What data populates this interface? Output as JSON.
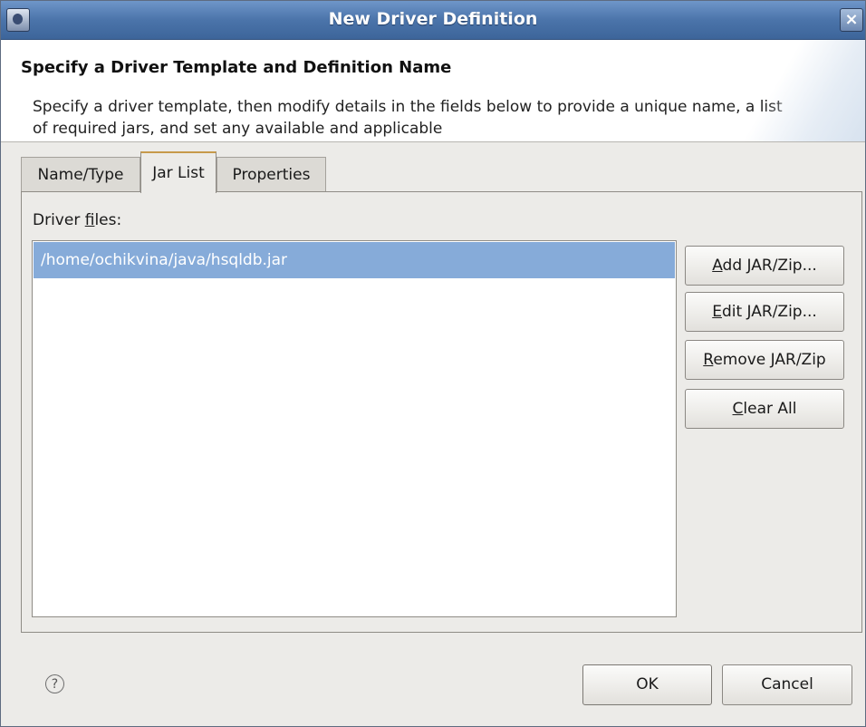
{
  "window": {
    "title": "New Driver Definition",
    "close_glyph": "×",
    "app_icon": "eclipse-icon"
  },
  "banner": {
    "title": "Specify a Driver Template and Definition Name",
    "description": "Specify a driver template, then modify details in the fields below to provide a unique name, a list of required jars, and set any available and applicable"
  },
  "tabs": [
    {
      "label": "Name/Type",
      "active": false
    },
    {
      "label": "Jar List",
      "active": true
    },
    {
      "label": "Properties",
      "active": false
    }
  ],
  "jar_list": {
    "label_prefix": "Driver ",
    "label_mnemonic": "f",
    "label_suffix": "iles:",
    "files": [
      "/home/ochikvina/java/hsqldb.jar"
    ],
    "selected_index": 0,
    "selection_color": "#86abd9"
  },
  "buttons": {
    "add": {
      "mnemonic": "A",
      "rest": "dd JAR/Zip..."
    },
    "edit": {
      "mnemonic": "E",
      "rest": "dit JAR/Zip..."
    },
    "remove": {
      "mnemonic": "R",
      "rest": "emove JAR/Zip"
    },
    "clear": {
      "mnemonic": "C",
      "rest": "lear All"
    },
    "ok": "OK",
    "cancel": "Cancel"
  },
  "help": {
    "glyph": "?",
    "icon": "help-icon"
  }
}
